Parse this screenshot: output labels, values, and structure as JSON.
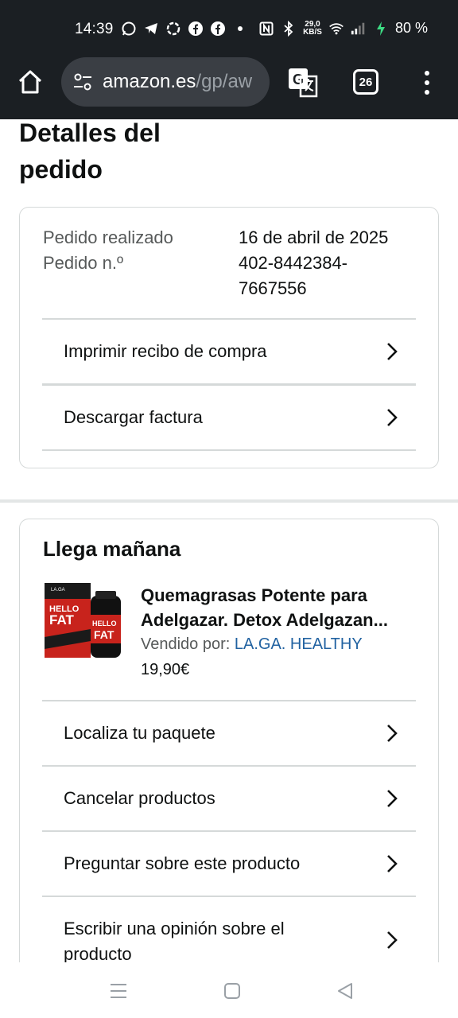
{
  "status_bar": {
    "time": "14:39",
    "net_speed_top": "29,0",
    "net_speed_bottom": "KB/S",
    "battery": "80 %",
    "icons": [
      "whatsapp-icon",
      "telegram-icon",
      "openai-icon",
      "facebook-icon",
      "facebook-icon",
      "dot-icon",
      "nfc-icon",
      "bluetooth-icon",
      "wifi-icon",
      "signal-icon",
      "charging-icon"
    ]
  },
  "browser": {
    "url_domain": "amazon.es",
    "url_path": "/gp/aw",
    "tab_count": "26",
    "colors": {
      "bar": "#1b1f23",
      "url_bg": "#3a3e44"
    }
  },
  "page": {
    "title_line1": "Detalles del",
    "title_line2": "pedido"
  },
  "order_info": {
    "placed_label": "Pedido realizado",
    "placed_value": "16 de abril de 2025",
    "number_label": "Pedido n.º",
    "number_value_line1": "402-8442384-",
    "number_value_line2": "7667556",
    "links": [
      "Imprimir recibo de compra",
      "Descargar factura"
    ]
  },
  "shipment": {
    "heading": "Llega mañana",
    "product": {
      "title_line1": "Quemagrasas Potente para",
      "title_line2": "Adelgazar. Detox Adelgazan...",
      "sold_by_label": "Vendido por:",
      "seller": "LA.GA. HEALTHY",
      "price": "19,90€",
      "image_text_top": "HELLO",
      "image_text_bottom": "FAT",
      "image_brand": "LA.GA"
    },
    "actions": [
      "Localiza tu paquete",
      "Cancelar productos",
      "Preguntar sobre este producto",
      "Escribir una opinión sobre el",
      "producto"
    ]
  },
  "colors": {
    "link_blue": "#2162a1",
    "secondary_text": "#565959",
    "border": "#d5d9d9"
  }
}
